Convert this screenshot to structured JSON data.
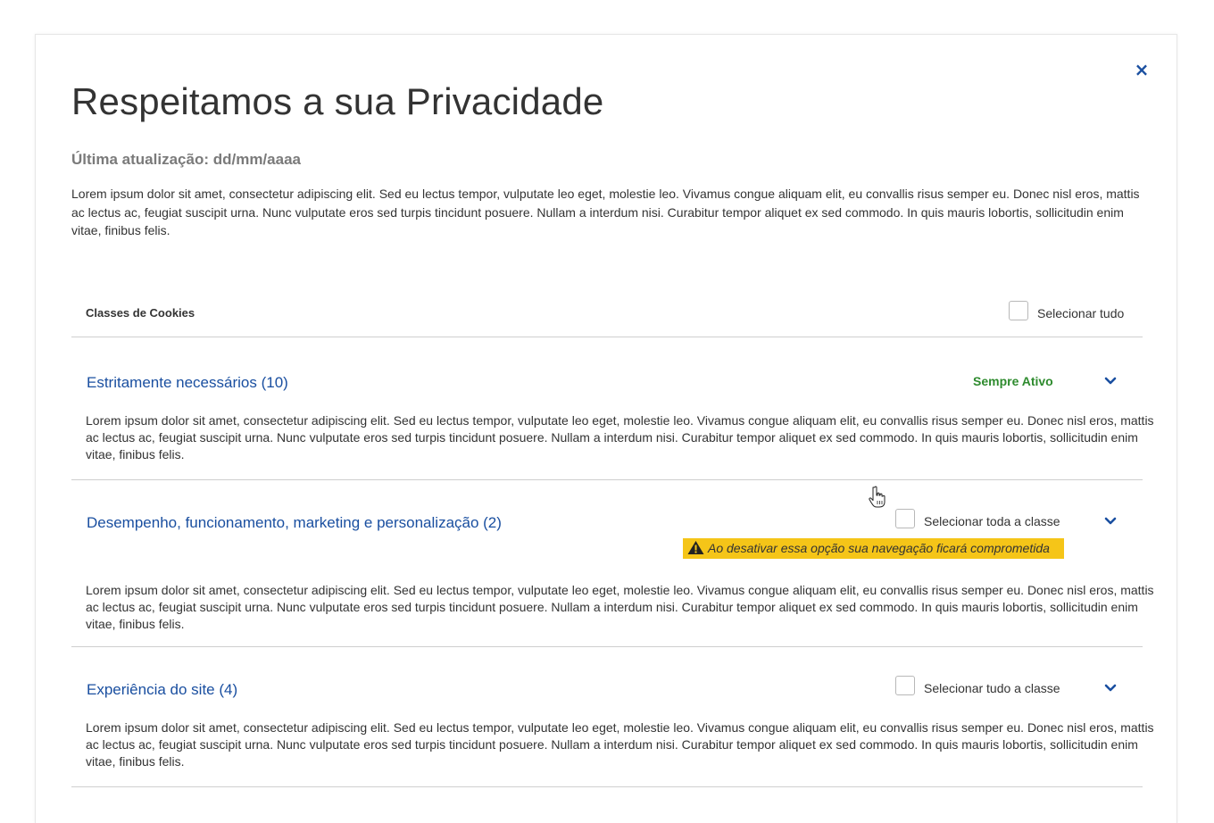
{
  "modal": {
    "close_label": "×",
    "title": "Respeitamos a sua Privacidade",
    "updated": "Última atualização: dd/mm/aaaa",
    "intro": "Lorem ipsum dolor sit amet, consectetur adipiscing elit. Sed eu lectus tempor, vulputate leo eget, molestie leo. Vivamus congue aliquam elit, eu convallis risus semper eu. Donec nisl eros, mattis ac lectus ac, feugiat suscipit urna. Nunc vulputate eros sed turpis tincidunt posuere. Nullam a interdum nisi. Curabitur tempor aliquet ex sed commodo. In quis mauris lobortis, sollicitudin enim vitae, finibus felis."
  },
  "classes_header": {
    "label": "Classes de Cookies",
    "select_all_label": "Selecionar tudo",
    "select_all_checked": false
  },
  "sections": [
    {
      "title": "Estritamente necessários (10)",
      "status": "Sempre Ativo",
      "description": "Lorem ipsum dolor sit amet, consectetur adipiscing elit. Sed eu lectus tempor, vulputate leo eget, molestie leo. Vivamus congue aliquam elit, eu convallis risus semper eu. Donec nisl eros, mattis ac lectus ac, feugiat suscipit urna. Nunc vulputate eros sed turpis tincidunt posuere. Nullam a interdum nisi. Curabitur tempor aliquet ex sed commodo. In quis mauris lobortis, sollicitudin enim vitae, finibus felis."
    },
    {
      "title": "Desempenho, funcionamento, marketing e personalização (2)",
      "checkbox_label": "Selecionar toda a classe",
      "checked": false,
      "warning": "Ao desativar essa opção sua navegação ficará comprometida",
      "description": "Lorem ipsum dolor sit amet, consectetur adipiscing elit. Sed eu lectus tempor, vulputate leo eget, molestie leo. Vivamus congue aliquam elit, eu convallis risus semper eu. Donec nisl eros, mattis ac lectus ac, feugiat suscipit urna. Nunc vulputate eros sed turpis tincidunt posuere. Nullam a interdum nisi. Curabitur tempor aliquet ex sed commodo. In quis mauris lobortis, sollicitudin enim vitae, finibus felis."
    },
    {
      "title": "Experiência do site (4)",
      "checkbox_label": "Selecionar tudo a classe",
      "checked": false,
      "description": "Lorem ipsum dolor sit amet, consectetur adipiscing elit. Sed eu lectus tempor, vulputate leo eget, molestie leo. Vivamus congue aliquam elit, eu convallis risus semper eu. Donec nisl eros, mattis ac lectus ac, feugiat suscipit urna. Nunc vulputate eros sed turpis tincidunt posuere. Nullam a interdum nisi. Curabitur tempor aliquet ex sed commodo. In quis mauris lobortis, sollicitudin enim vitae, finibus felis."
    }
  ],
  "icons": {
    "close": "close-icon",
    "chevron": "chevron-down-icon",
    "warning": "warning-icon",
    "cursor": "hand-pointer-icon"
  },
  "colors": {
    "accent": "#1a4fa0",
    "status_green": "#2e8b2e",
    "warning_bg": "#f5c518",
    "text": "#333333",
    "muted": "#7a7a7a",
    "divider": "#cfcfcf"
  }
}
